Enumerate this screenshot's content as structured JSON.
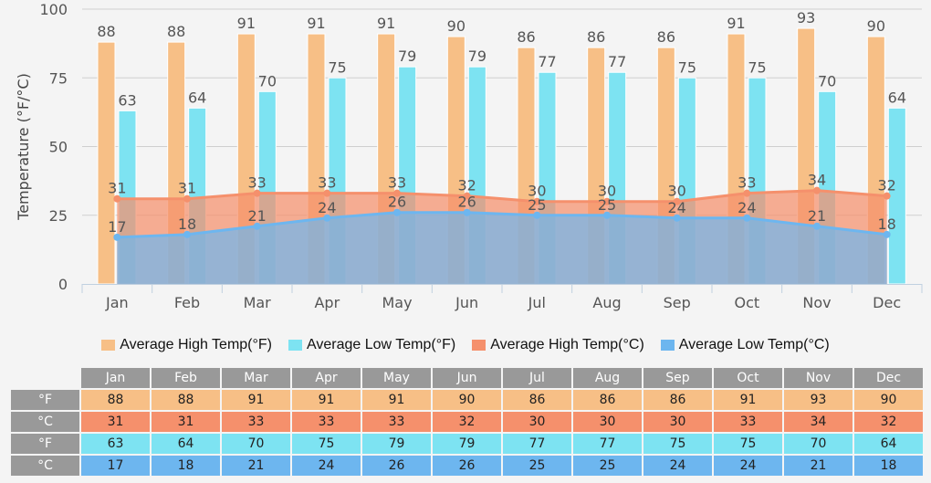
{
  "colors": {
    "high_f": "#f7bf86",
    "low_f": "#7de3f2",
    "high_c": "#f5906c",
    "low_c": "#6db6ef",
    "header_bg": "#999999"
  },
  "chart_data": {
    "type": "bar",
    "title": "",
    "xlabel": "",
    "ylabel": "Temperature (°F/°C)",
    "ylim": [
      0,
      100
    ],
    "yticks": [
      0,
      25,
      50,
      75,
      100
    ],
    "grid": true,
    "legend_position": "bottom",
    "categories": [
      "Jan",
      "Feb",
      "Mar",
      "Apr",
      "May",
      "Jun",
      "Jul",
      "Aug",
      "Sep",
      "Oct",
      "Nov",
      "Dec"
    ],
    "series": [
      {
        "name": "Average High Temp(°F)",
        "type": "bar",
        "color": "#f7bf86",
        "values": [
          88,
          88,
          91,
          91,
          91,
          90,
          86,
          86,
          86,
          91,
          93,
          90
        ]
      },
      {
        "name": "Average Low Temp(°F)",
        "type": "bar",
        "color": "#7de3f2",
        "values": [
          63,
          64,
          70,
          75,
          79,
          79,
          77,
          77,
          75,
          75,
          70,
          64
        ]
      },
      {
        "name": "Average High Temp(°C)",
        "type": "area",
        "color": "#f5906c",
        "values": [
          31,
          31,
          33,
          33,
          33,
          32,
          30,
          30,
          30,
          33,
          34,
          32
        ]
      },
      {
        "name": "Average Low Temp(°C)",
        "type": "area",
        "color": "#6db6ef",
        "values": [
          17,
          18,
          21,
          24,
          26,
          26,
          25,
          25,
          24,
          24,
          21,
          18
        ]
      }
    ]
  },
  "legend": [
    {
      "label": "Average High Temp(°F)",
      "color": "#f7bf86"
    },
    {
      "label": "Average Low Temp(°F)",
      "color": "#7de3f2"
    },
    {
      "label": "Average High Temp(°C)",
      "color": "#f5906c"
    },
    {
      "label": "Average Low Temp(°C)",
      "color": "#6db6ef"
    }
  ],
  "table": {
    "months": [
      "Jan",
      "Feb",
      "Mar",
      "Apr",
      "May",
      "Jun",
      "Jul",
      "Aug",
      "Sep",
      "Oct",
      "Nov",
      "Dec"
    ],
    "rows": [
      {
        "unit": "°F",
        "color": "#f7bf86",
        "values": [
          88,
          88,
          91,
          91,
          91,
          90,
          86,
          86,
          86,
          91,
          93,
          90
        ]
      },
      {
        "unit": "°C",
        "color": "#f5906c",
        "values": [
          31,
          31,
          33,
          33,
          33,
          32,
          30,
          30,
          30,
          33,
          34,
          32
        ]
      },
      {
        "unit": "°F",
        "color": "#7de3f2",
        "values": [
          63,
          64,
          70,
          75,
          79,
          79,
          77,
          77,
          75,
          75,
          70,
          64
        ]
      },
      {
        "unit": "°C",
        "color": "#6db6ef",
        "values": [
          17,
          18,
          21,
          24,
          26,
          26,
          25,
          25,
          24,
          24,
          21,
          18
        ]
      }
    ]
  }
}
